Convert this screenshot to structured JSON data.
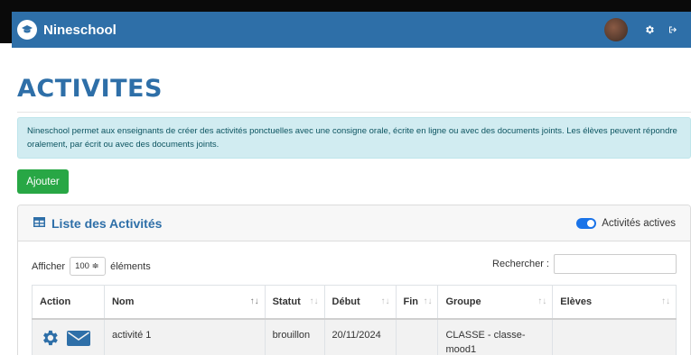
{
  "app": {
    "name": "Nineschool"
  },
  "page": {
    "title": "ACTIVITES"
  },
  "info": {
    "text": "Nineschool permet aux enseignants de créer des activités ponctuelles avec une consigne orale, écrite en ligne ou avec des documents joints. Les élèves peuvent répondre oralement, par écrit ou avec des documents joints."
  },
  "actions": {
    "add_label": "Ajouter"
  },
  "card": {
    "title": "Liste des Activités",
    "toggle_label": "Activités actives",
    "toggle_on": true
  },
  "table_controls": {
    "length_prefix": "Afficher",
    "length_value": "100 ≑",
    "length_suffix": "éléments",
    "search_label": "Rechercher :"
  },
  "table": {
    "headers": [
      "Action",
      "Nom",
      "Statut",
      "Début",
      "Fin",
      "Groupe",
      "Elèves"
    ],
    "rows": [
      {
        "nom": "activité 1",
        "statut": "brouillon",
        "debut": "20/11/2024",
        "fin": "",
        "groupe": "CLASSE - classe-mood1",
        "eleves": ""
      }
    ]
  },
  "colors": {
    "brand": "#2E6FA8",
    "success": "#28a745",
    "info_bg": "#d1ecf1",
    "toggle": "#1a73e8"
  },
  "icons": [
    "graduation-cap-icon",
    "gear-icon",
    "logout-icon",
    "table-icon",
    "sort-icon",
    "envelope-icon"
  ]
}
